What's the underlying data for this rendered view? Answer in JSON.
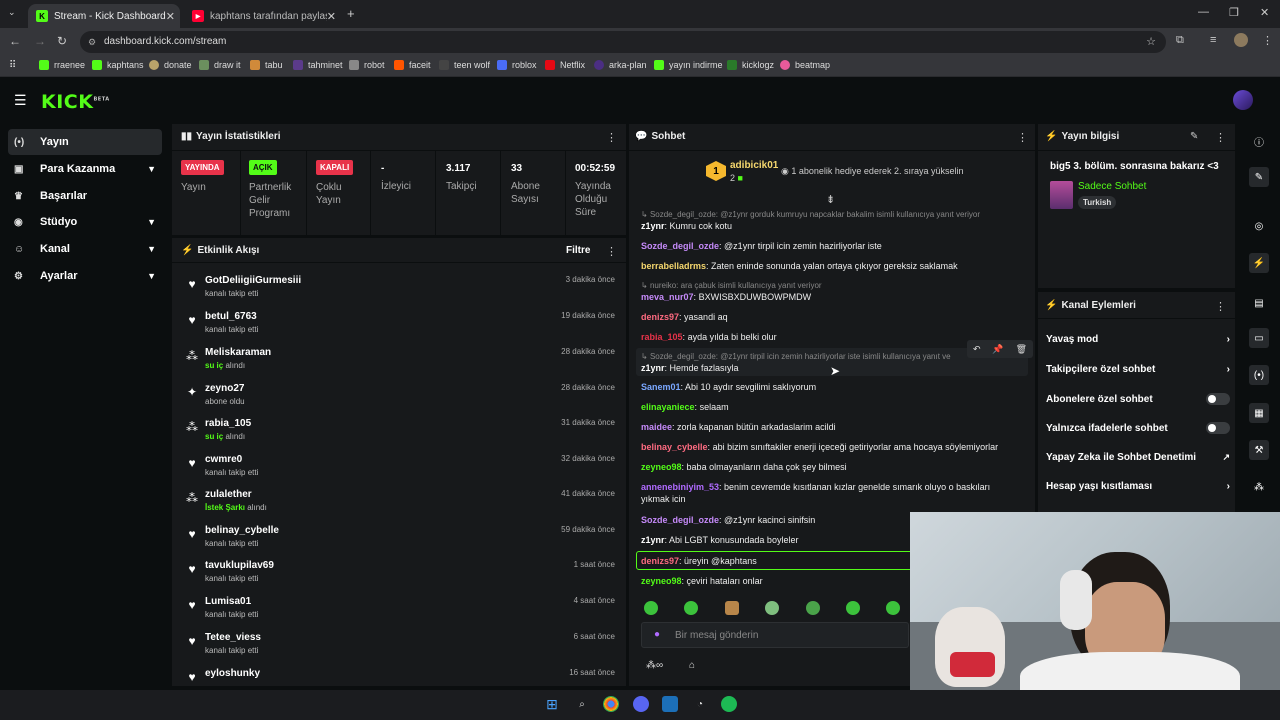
{
  "browser": {
    "tabs": [
      {
        "title": "Stream - Kick Dashboard",
        "active": true
      },
      {
        "title": "kaphtans tarafından paylaşılan",
        "active": false
      }
    ],
    "new_tab": "+",
    "url": "dashboard.kick.com/stream",
    "bookmarks": [
      "rraenee",
      "kaphtans",
      "donate",
      "draw it",
      "tabu",
      "tahminet",
      "robot",
      "faceit",
      "teen wolf",
      "roblox",
      "Netflix",
      "arka-plan",
      "yayın indirme",
      "kicklogz",
      "beatmap"
    ]
  },
  "app": {
    "logo": "KICK",
    "logo_sup": "BETA"
  },
  "sidebar": {
    "items": [
      {
        "label": "Yayın",
        "icon": "broadcast-icon",
        "active": true
      },
      {
        "label": "Para Kazanma",
        "icon": "money-icon",
        "chevron": true
      },
      {
        "label": "Başarılar",
        "icon": "trophy-icon"
      },
      {
        "label": "Stüdyo",
        "icon": "studio-icon",
        "chevron": true
      },
      {
        "label": "Kanal",
        "icon": "channel-icon",
        "chevron": true
      },
      {
        "label": "Ayarlar",
        "icon": "gear-icon",
        "chevron": true
      }
    ]
  },
  "stats": {
    "title": "Yayın İstatistikleri",
    "live_badge": "YAYINDA",
    "live_label": "Yayın",
    "partner_badge": "AÇIK",
    "partner_label_1": "Partnerlik",
    "partner_label_2": "Gelir",
    "partner_label_3": "Programı",
    "multi_badge": "KAPALI",
    "multi_label_1": "Çoklu",
    "multi_label_2": "Yayın",
    "viewers_value": "-",
    "viewers_label": "İzleyici",
    "followers_value": "3.117",
    "followers_label": "Takipçi",
    "subs_value": "33",
    "subs_label_1": "Abone",
    "subs_label_2": "Sayısı",
    "uptime_value": "00:52:59",
    "uptime_label_1": "Yayında",
    "uptime_label_2": "Olduğu",
    "uptime_label_3": "Süre"
  },
  "activity": {
    "title": "Etkinlik Akışı",
    "filter": "Filtre",
    "events": [
      {
        "name": "GotDeliigiiGurmesiii",
        "desc": "kanalı takip etti",
        "time": "3 dakika önce",
        "icon": "heart-icon"
      },
      {
        "name": "betul_6763",
        "desc": "kanalı takip etti",
        "time": "19 dakika önce",
        "icon": "heart-icon"
      },
      {
        "name": "Meliskaraman",
        "highlight": "su iç",
        "desc": "alındı",
        "time": "28 dakika önce",
        "icon": "points-icon"
      },
      {
        "name": "zeyno27",
        "desc": "abone oldu",
        "time": "28 dakika önce",
        "icon": "star-icon"
      },
      {
        "name": "rabia_105",
        "highlight": "su iç",
        "desc": "alındı",
        "time": "31 dakika önce",
        "icon": "points-icon"
      },
      {
        "name": "cwmre0",
        "desc": "kanalı takip etti",
        "time": "32 dakika önce",
        "icon": "heart-icon"
      },
      {
        "name": "zulalether",
        "highlight": "İstek Şarkı",
        "desc": "alındı",
        "time": "41 dakika önce",
        "icon": "points-icon"
      },
      {
        "name": "belinay_cybelle",
        "desc": "kanalı takip etti",
        "time": "59 dakika önce",
        "icon": "heart-icon"
      },
      {
        "name": "tavuklupilav69",
        "desc": "kanalı takip etti",
        "time": "1 saat önce",
        "icon": "heart-icon"
      },
      {
        "name": "Lumisa01",
        "desc": "kanalı takip etti",
        "time": "4 saat önce",
        "icon": "heart-icon"
      },
      {
        "name": "Tetee_viess",
        "desc": "kanalı takip etti",
        "time": "6 saat önce",
        "icon": "heart-icon"
      },
      {
        "name": "eyloshunky",
        "desc": "",
        "time": "16 saat önce",
        "icon": "heart-icon"
      }
    ]
  },
  "chat": {
    "title": "Sohbet",
    "pinned_rank": "1",
    "pinned_user": "adibicik01",
    "pinned_count": "2",
    "pinned_text": "1 abonelik hediye ederek 2. sıraya yükselin",
    "input_placeholder": "Bir mesaj gönderin",
    "messages": [
      {
        "reply": "Sozde_degil_ozde: @z1ynr gorduk kumruyu napcaklar bakalim isimli kullanıcıya yanıt veriyor",
        "user": "z1ynr",
        "text": "Kumru cok kotu",
        "color": "#ffffff"
      },
      {
        "user": "Sozde_degil_ozde",
        "text": "@z1ynr tirpil icin zemin hazirliyorlar iste",
        "color": "#c58af9"
      },
      {
        "user": "berrabelladrms",
        "text": "Zaten eninde sonunda yalan ortaya çıkıyor gereksiz saklamak",
        "color": "#f5d76e"
      },
      {
        "reply": "nureiko: ara çabuk isimli kullanıcıya yanıt veriyor",
        "user": "meva_nur07",
        "text": "BXWISBXDUWBOWPMDW",
        "color": "#c58af9"
      },
      {
        "user": "denizs97",
        "text": "yasandi aq",
        "color": "#ff6b81"
      },
      {
        "user": "rabia_105",
        "text": "ayda yılda bi belki olur",
        "color": "#e8334a"
      },
      {
        "reply": "Sozde_degil_ozde: @z1ynr tirpil icin zemin hazirliyorlar iste isimli kullanıcıya yanıt ve",
        "user": "z1ynr",
        "text": "Hemde fazlasıyla",
        "color": "#ffffff"
      },
      {
        "user": "Sanem01",
        "text": "Abi 10 aydır sevgilimi saklıyorum",
        "color": "#7aa7ff"
      },
      {
        "user": "elinayaniece",
        "text": "selaam",
        "color": "#53fc18"
      },
      {
        "user": "maidee",
        "text": "zorla kapanan bütün arkadaslarim acildi",
        "color": "#c58af9"
      },
      {
        "user": "belinay_cybelle",
        "text": "abi bizim sınıftakiler enerji içeceği getiriyorlar ama hocaya söylemiyorlar",
        "color": "#ff6b81"
      },
      {
        "user": "zeyneo98",
        "text": "baba olmayanların daha çok şey bilmesi",
        "color": "#53fc18"
      },
      {
        "user": "annenebiniyim_53",
        "text": "benim cevremde kısıtlanan kızlar genelde sımarık oluyo o baskıları yıkmak icin",
        "color": "#b06bff"
      },
      {
        "user": "Sozde_degil_ozde",
        "text": "@z1ynr kacinci sinifsin",
        "color": "#c58af9"
      },
      {
        "user": "z1ynr",
        "text": "Abi LGBT konusundada boyleler",
        "color": "#ffffff"
      },
      {
        "user": "denizs97",
        "text": "üreyin @kaphtans",
        "color": "#ff6b81",
        "highlighted": true
      },
      {
        "user": "zeyneo98",
        "text": "çeviri hataları onlar",
        "color": "#53fc18"
      }
    ]
  },
  "stream_info": {
    "title": "Yayın bilgisi",
    "stream_title": "big5 3. bölüm. sonrasına bakarız <3",
    "category": "Sadece Sohbet",
    "language": "Turkish"
  },
  "channel_actions": {
    "title": "Kanal Eylemleri",
    "items": [
      {
        "label": "Yavaş mod",
        "control": "chevron"
      },
      {
        "label": "Takipçilere özel sohbet",
        "control": "chevron"
      },
      {
        "label": "Abonelere özel sohbet",
        "control": "toggle"
      },
      {
        "label": "Yalnızca ifadelerle sohbet",
        "control": "toggle"
      },
      {
        "label": "Yapay Zeka ile Sohbet Denetimi",
        "control": "external"
      },
      {
        "label": "Hesap yaşı kısıtlaması",
        "control": "chevron"
      }
    ]
  },
  "colors": {
    "brand": "#53fc18",
    "live": "#e8334a",
    "panel": "#17191b"
  }
}
